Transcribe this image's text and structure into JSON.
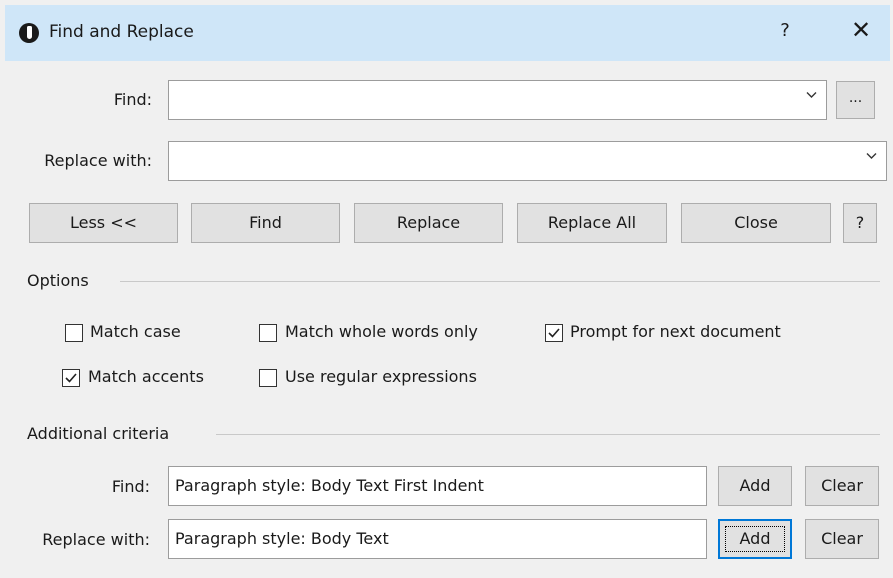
{
  "window": {
    "title": "Find and Replace",
    "help_glyph": "?",
    "close_glyph": "✕"
  },
  "find": {
    "label": "Find:",
    "value": "",
    "more_button": "..."
  },
  "replace": {
    "label": "Replace with:",
    "value": ""
  },
  "buttons": {
    "less": "Less <<",
    "find": "Find",
    "replace": "Replace",
    "replace_all": "Replace All",
    "close": "Close",
    "help": "?"
  },
  "options": {
    "header": "Options",
    "items": [
      {
        "label": "Match case",
        "checked": false
      },
      {
        "label": "Match whole words only",
        "checked": false
      },
      {
        "label": "Prompt for next document",
        "checked": true
      },
      {
        "label": "Match accents",
        "checked": true
      },
      {
        "label": "Use regular expressions",
        "checked": false
      }
    ]
  },
  "criteria": {
    "header": "Additional criteria",
    "find_label": "Find:",
    "find_value": "Paragraph style: Body Text First Indent",
    "replace_label": "Replace with:",
    "replace_value": "Paragraph style: Body Text",
    "add_label": "Add",
    "clear_label": "Clear"
  }
}
